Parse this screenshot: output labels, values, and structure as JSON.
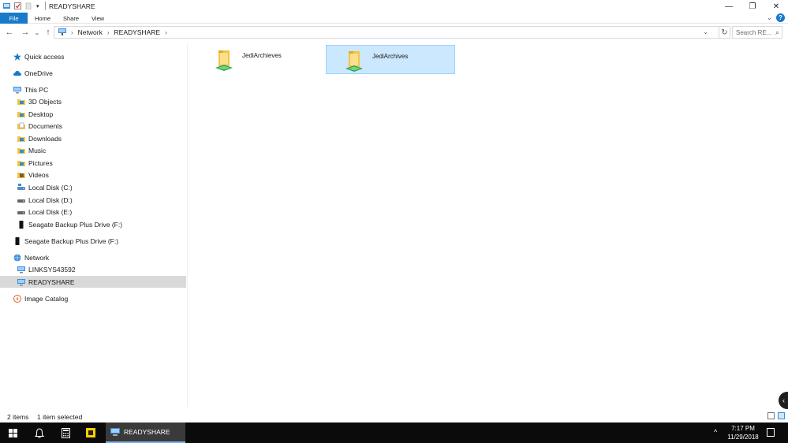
{
  "window": {
    "title": "READYSHARE",
    "minimize_glyph": "—",
    "maximize_glyph": "❐",
    "close_glyph": "✕"
  },
  "ribbon": {
    "tabs": [
      "File",
      "Home",
      "Share",
      "View"
    ],
    "expand_glyph": "⌄",
    "help_glyph": "?"
  },
  "address": {
    "back_glyph": "←",
    "forward_glyph": "→",
    "recent_glyph": "⌄",
    "up_glyph": "↑",
    "crumbs": [
      "Network",
      "READYSHARE"
    ],
    "crumb_sep": "›",
    "dropdown_glyph": "⌄",
    "refresh_glyph": "↻",
    "search_placeholder": "Search RE...",
    "search_glyph": "⌕"
  },
  "nav": {
    "items": [
      {
        "label": "Quick access",
        "icon": "star-icon",
        "color": "#1979ca"
      },
      {
        "label": "OneDrive",
        "icon": "cloud-icon",
        "color": "#1979ca"
      },
      {
        "label": "This PC",
        "icon": "computer-icon",
        "color": "#3c8cd8"
      },
      {
        "label": "3D Objects",
        "icon": "cube-icon",
        "color": "#2b8fd8"
      },
      {
        "label": "Desktop",
        "icon": "desktop-icon",
        "color": "#2b8fd8"
      },
      {
        "label": "Documents",
        "icon": "documents-icon",
        "color": "#8a9ab0"
      },
      {
        "label": "Downloads",
        "icon": "download-icon",
        "color": "#2b8fd8"
      },
      {
        "label": "Music",
        "icon": "music-icon",
        "color": "#2b8fd8"
      },
      {
        "label": "Pictures",
        "icon": "pictures-icon",
        "color": "#2b8fd8"
      },
      {
        "label": "Videos",
        "icon": "videos-icon",
        "color": "#7a5a30"
      },
      {
        "label": "Local Disk (C:)",
        "icon": "windows-drive-icon",
        "color": "#5a8ac0"
      },
      {
        "label": "Local Disk (D:)",
        "icon": "drive-icon",
        "color": "#666666"
      },
      {
        "label": "Local Disk (E:)",
        "icon": "drive-icon",
        "color": "#666666"
      },
      {
        "label": "Seagate Backup Plus Drive (F:)",
        "icon": "usb-drive-icon",
        "color": "#111111"
      },
      {
        "label": "Seagate Backup Plus Drive (F:)",
        "icon": "usb-drive-icon",
        "color": "#111111"
      },
      {
        "label": "Network",
        "icon": "network-icon",
        "color": "#3c8cd8"
      },
      {
        "label": "LINKSYS43592",
        "icon": "network-computer-icon",
        "color": "#3c8cd8"
      },
      {
        "label": "READYSHARE",
        "icon": "network-computer-icon",
        "color": "#3c8cd8"
      },
      {
        "label": "Image Catalog",
        "icon": "image-catalog-icon",
        "color": "#d6622a"
      }
    ]
  },
  "content": {
    "items": [
      {
        "label": "JediArchieves",
        "selected": false
      },
      {
        "label": "JediArchives",
        "selected": true
      }
    ]
  },
  "status": {
    "count": "2 items",
    "selected": "1 item selected"
  },
  "taskbar": {
    "app_label": "READYSHARE",
    "tray_glyph": "^",
    "time": "7:17 PM",
    "date": "11/29/2018"
  },
  "colors": {
    "accent": "#1979ca",
    "selection": "#cce8ff",
    "selection_border": "#99d1ff"
  }
}
